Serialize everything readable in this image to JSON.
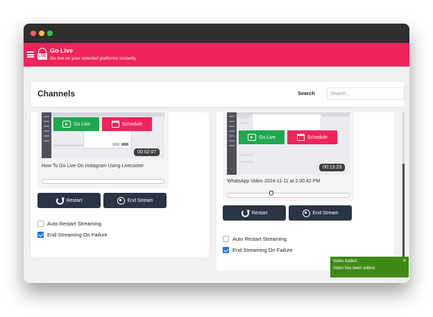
{
  "app": {
    "title": "Go Live",
    "subtitle": "Go live on your selected platforms instantly",
    "logo_text": "LIVE"
  },
  "header": {
    "title": "Channels",
    "search_label": "Search",
    "search_placeholder": "Search...",
    "search_value": ""
  },
  "videos": [
    {
      "title": "How To Go Live On Instagram Using Livecaster",
      "duration": "00:02:07",
      "go_live_label": "Go Live",
      "schedule_label": "Schedule",
      "restart_label": "Restart",
      "end_stream_label": "End Stream",
      "auto_restart_label": "Auto Restart Streaming",
      "auto_restart_checked": false,
      "end_on_failure_label": "End Streaming On Failure",
      "end_on_failure_checked": true
    },
    {
      "title": "WhatsApp Video 2024-11-11 at 2.00.42 PM",
      "duration": "00:13:23",
      "go_live_label": "Go Live",
      "schedule_label": "Schedule",
      "restart_label": "Restart",
      "end_stream_label": "End Stream",
      "auto_restart_label": "Auto Restart Streaming",
      "auto_restart_checked": false,
      "end_on_failure_label": "End Streaming On Failure",
      "end_on_failure_checked": true
    }
  ],
  "toast": {
    "title": "Video Added",
    "message": "Video has been added.",
    "close": "×"
  },
  "colors": {
    "brand": "#f0245a",
    "go_live": "#1fa84f",
    "action_button": "#2a3444",
    "toast": "#3f8a17",
    "checkbox_checked": "#1a73e8"
  },
  "icons": {
    "menu": "hamburger-menu-icon",
    "logo": "live-broadcast-icon",
    "go_live": "tv-play-icon",
    "schedule": "calendar-icon",
    "restart": "restart-icon",
    "end_stream": "stop-circle-icon",
    "toast_close": "close-icon"
  }
}
